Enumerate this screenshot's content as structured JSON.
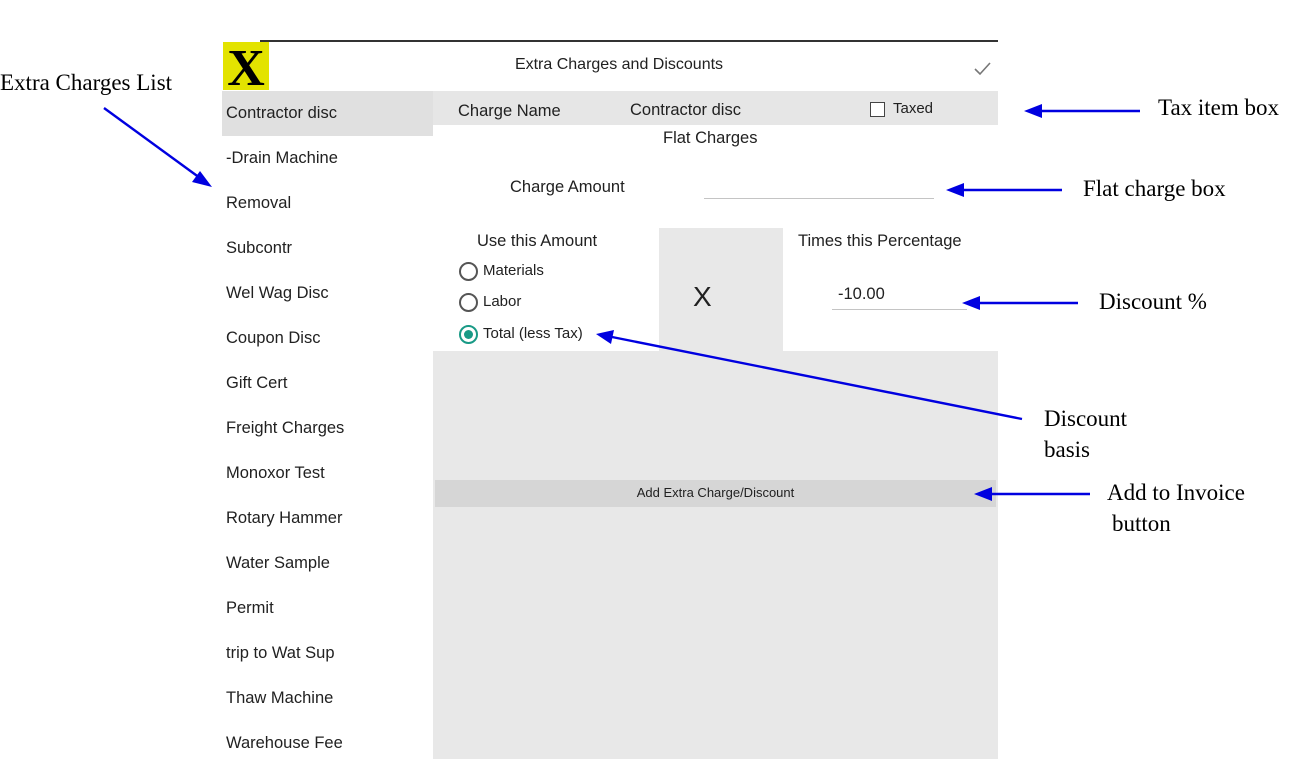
{
  "app": {
    "title": "Extra Charges and Discounts",
    "logo_letter": "X"
  },
  "sidebar": {
    "items": [
      {
        "label": "Contractor disc",
        "selected": true
      },
      {
        "label": "-Drain Machine"
      },
      {
        "label": "Removal"
      },
      {
        "label": "Subcontr"
      },
      {
        "label": "Wel Wag Disc"
      },
      {
        "label": "Coupon Disc"
      },
      {
        "label": "Gift Cert"
      },
      {
        "label": "Freight Charges"
      },
      {
        "label": "Monoxor Test"
      },
      {
        "label": "Rotary Hammer"
      },
      {
        "label": "Water Sample"
      },
      {
        "label": "Permit"
      },
      {
        "label": "trip to Wat Sup"
      },
      {
        "label": "Thaw Machine"
      },
      {
        "label": "Warehouse Fee"
      }
    ]
  },
  "form": {
    "charge_name_label": "Charge Name",
    "charge_name_value": "Contractor disc",
    "taxed_label": "Taxed",
    "taxed_checked": false,
    "flat_charges_heading": "Flat Charges",
    "charge_amount_label": "Charge Amount",
    "charge_amount_value": "",
    "use_amount_heading": "Use this Amount",
    "basis_options": [
      {
        "label": "Materials",
        "selected": false
      },
      {
        "label": "Labor",
        "selected": false
      },
      {
        "label": "Total (less Tax)",
        "selected": true
      }
    ],
    "multiply_symbol": "X",
    "times_percentage_heading": "Times this Percentage",
    "percentage_value": "-10.00",
    "add_button_label": "Add Extra Charge/Discount"
  },
  "annotations": {
    "extra_charges_list": "Extra Charges List",
    "tax_item_box": "Tax item box",
    "flat_charge_box": "Flat charge box",
    "discount_pct": "Discount %",
    "discount_basis_line1": "Discount",
    "discount_basis_line2": "basis",
    "add_to_invoice_line1": "Add to Invoice",
    "add_to_invoice_line2": "button"
  },
  "colors": {
    "accent": "#199a86",
    "arrow": "#0000e0",
    "logo_bg": "#e3e300",
    "selected_item": "#e0e0e0",
    "panel_grey": "#e8e8e8"
  }
}
